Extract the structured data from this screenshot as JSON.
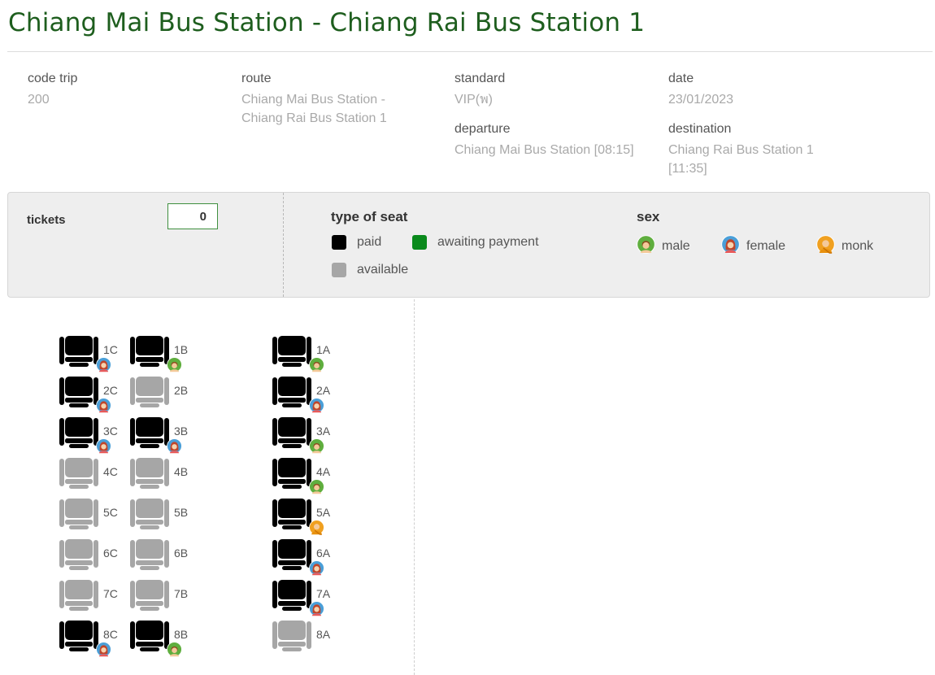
{
  "page_title": "Chiang Mai Bus Station - Chiang Rai Bus Station 1",
  "trip_info": {
    "code_trip": {
      "label": "code trip",
      "value": "200"
    },
    "route": {
      "label": "route",
      "value": "Chiang Mai Bus Station - Chiang Rai Bus Station 1"
    },
    "standard": {
      "label": "standard",
      "value": "VIP(พ)"
    },
    "date": {
      "label": "date",
      "value": "23/01/2023"
    },
    "departure": {
      "label": "departure",
      "value": "Chiang Mai Bus Station [08:15]"
    },
    "destination": {
      "label": "destination",
      "value": "Chiang Rai Bus Station 1 [11:35]"
    }
  },
  "tickets": {
    "label": "tickets",
    "value": "0"
  },
  "seat_legend": {
    "title": "type of seat",
    "items": [
      {
        "label": "paid",
        "color": "#000000"
      },
      {
        "label": "awaiting payment",
        "color": "#0a8a1c"
      },
      {
        "label": "available",
        "color": "#a6a6a6"
      }
    ]
  },
  "sex_legend": {
    "title": "sex",
    "items": [
      {
        "label": "male",
        "icon": "male-icon"
      },
      {
        "label": "female",
        "icon": "female-icon"
      },
      {
        "label": "monk",
        "icon": "monk-icon"
      }
    ]
  },
  "colors": {
    "paid": "#000000",
    "available": "#a6a6a6",
    "awaiting": "#0a8a1c",
    "title": "#1e5e1e"
  },
  "seats": [
    {
      "id": "1C",
      "status": "paid",
      "passenger": "female"
    },
    {
      "id": "1B",
      "status": "paid",
      "passenger": "male"
    },
    {
      "id": "1A",
      "status": "paid",
      "passenger": "male"
    },
    {
      "id": "2C",
      "status": "paid",
      "passenger": "female"
    },
    {
      "id": "2B",
      "status": "available",
      "passenger": null
    },
    {
      "id": "2A",
      "status": "paid",
      "passenger": "female"
    },
    {
      "id": "3C",
      "status": "paid",
      "passenger": "female"
    },
    {
      "id": "3B",
      "status": "paid",
      "passenger": "female"
    },
    {
      "id": "3A",
      "status": "paid",
      "passenger": "male"
    },
    {
      "id": "4C",
      "status": "available",
      "passenger": null
    },
    {
      "id": "4B",
      "status": "available",
      "passenger": null
    },
    {
      "id": "4A",
      "status": "paid",
      "passenger": "male"
    },
    {
      "id": "5C",
      "status": "available",
      "passenger": null
    },
    {
      "id": "5B",
      "status": "available",
      "passenger": null
    },
    {
      "id": "5A",
      "status": "paid",
      "passenger": "monk"
    },
    {
      "id": "6C",
      "status": "available",
      "passenger": null
    },
    {
      "id": "6B",
      "status": "available",
      "passenger": null
    },
    {
      "id": "6A",
      "status": "paid",
      "passenger": "female"
    },
    {
      "id": "7C",
      "status": "available",
      "passenger": null
    },
    {
      "id": "7B",
      "status": "available",
      "passenger": null
    },
    {
      "id": "7A",
      "status": "paid",
      "passenger": "female"
    },
    {
      "id": "8C",
      "status": "paid",
      "passenger": "female"
    },
    {
      "id": "8B",
      "status": "paid",
      "passenger": "male"
    },
    {
      "id": "8A",
      "status": "available",
      "passenger": null
    }
  ]
}
